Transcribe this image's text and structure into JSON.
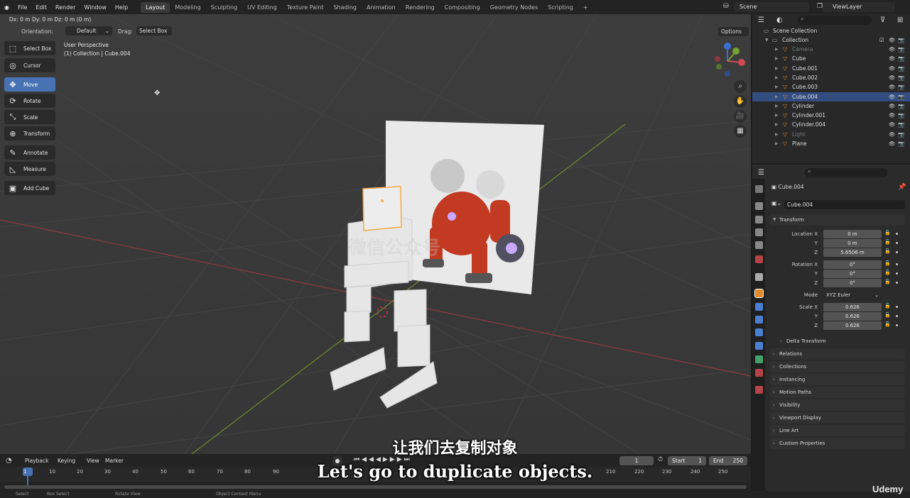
{
  "menubar": {
    "items": [
      "File",
      "Edit",
      "Render",
      "Window",
      "Help"
    ],
    "workspaces": [
      "Layout",
      "Modeling",
      "Sculpting",
      "UV Editing",
      "Texture Paint",
      "Shading",
      "Animation",
      "Rendering",
      "Compositing",
      "Geometry Nodes",
      "Scripting"
    ],
    "active_workspace": "Layout",
    "add_tab": "+",
    "scene": "Scene",
    "view_layer": "ViewLayer"
  },
  "viewport_header": {
    "status_text": "Dx: 0 m   Dy: 0 m   Dz: 0 m (0 m)",
    "orientation_label": "Orientation:",
    "orientation_value": "Default",
    "drag_label": "Drag:",
    "drag_value": "Select Box",
    "options": "Options"
  },
  "viewport_info": {
    "view_name": "User Perspective",
    "context": "(1) Collection | Cube.004"
  },
  "toolbar": [
    {
      "label": "Select Box",
      "icon": "select-box-icon",
      "glyph": "⬚"
    },
    {
      "label": "Cursor",
      "icon": "cursor-icon",
      "glyph": "◎"
    },
    {
      "label": "Move",
      "icon": "move-icon",
      "glyph": "✥"
    },
    {
      "label": "Rotate",
      "icon": "rotate-icon",
      "glyph": "⟳"
    },
    {
      "label": "Scale",
      "icon": "scale-icon",
      "glyph": "⤡"
    },
    {
      "label": "Transform",
      "icon": "transform-icon",
      "glyph": "⊕"
    },
    {
      "label": "Annotate",
      "icon": "annotate-icon",
      "glyph": "✎"
    },
    {
      "label": "Measure",
      "icon": "measure-icon",
      "glyph": "📐"
    },
    {
      "label": "Add Cube",
      "icon": "add-cube-icon",
      "glyph": "▣"
    }
  ],
  "watermark": "微信公众号",
  "outliner": {
    "root": "Scene Collection",
    "collection": "Collection",
    "objects": [
      {
        "name": "Camera",
        "dim": true
      },
      {
        "name": "Cube",
        "dim": false
      },
      {
        "name": "Cube.001",
        "dim": false
      },
      {
        "name": "Cube.002",
        "dim": false
      },
      {
        "name": "Cube.003",
        "dim": false
      },
      {
        "name": "Cube.004",
        "dim": false,
        "selected": true
      },
      {
        "name": "Cylinder",
        "dim": false
      },
      {
        "name": "Cylinder.001",
        "dim": false
      },
      {
        "name": "Cylinder.004",
        "dim": false
      },
      {
        "name": "Light",
        "dim": true
      },
      {
        "name": "Plane",
        "dim": false
      }
    ]
  },
  "properties": {
    "object_name": "Cube.004",
    "data_name": "Cube.004",
    "transform_title": "Transform",
    "location": {
      "label": "Location X",
      "x": "0 m",
      "y": "0 m",
      "z": "5.6506 m"
    },
    "rotation": {
      "label": "Rotation X",
      "x": "0°",
      "y": "0°",
      "z": "0°"
    },
    "mode_label": "Mode",
    "mode_value": "XYZ Euler",
    "scale": {
      "label": "Scale X",
      "x": "0.626",
      "y": "0.626",
      "z": "0.626"
    },
    "axis_y": "Y",
    "axis_z": "Z",
    "delta_transform": "Delta Transform",
    "panels": [
      "Relations",
      "Collections",
      "Instancing",
      "Motion Paths",
      "Visibility",
      "Viewport Display",
      "Line Art",
      "Custom Properties"
    ]
  },
  "timeline": {
    "menus": [
      "Playback",
      "Keying",
      "View",
      "Marker"
    ],
    "current_frame": "1",
    "start_label": "Start",
    "start_value": "1",
    "end_label": "End",
    "end_value": "250",
    "ticks": [
      "1",
      "10",
      "20",
      "30",
      "40",
      "50",
      "60",
      "70",
      "80",
      "90",
      "210",
      "220",
      "230",
      "240",
      "250"
    ]
  },
  "statusbar": [
    "Select",
    "Box Select",
    "Rotate View",
    "Object Context Menu"
  ],
  "subtitle_zh": "让我们去复制对象",
  "subtitle_en": "Let's go to duplicate objects.",
  "brand": "Udemy",
  "colors": {
    "accent": "#4772b3",
    "selected_row": "#334d80",
    "object_orange": "#e08a2c"
  }
}
